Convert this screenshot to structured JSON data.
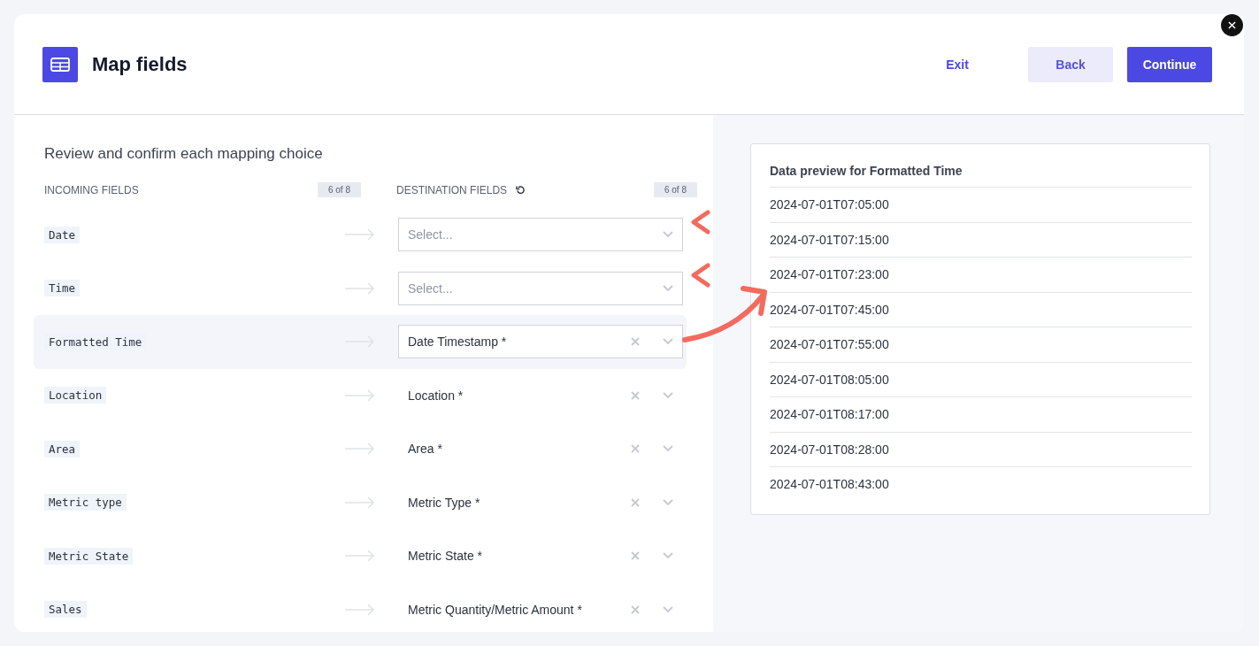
{
  "header": {
    "title": "Map fields",
    "actions": [
      {
        "label": "Exit",
        "kind": "link"
      },
      {
        "label": "Back",
        "kind": "secondary"
      },
      {
        "label": "Continue",
        "kind": "primary"
      }
    ]
  },
  "mapping": {
    "heading": "Review and confirm each mapping choice",
    "incoming_label": "INCOMING FIELDS",
    "incoming_count": "6 of 8",
    "destination_label": "DESTINATION FIELDS",
    "destination_count": "6 of 8",
    "rows": [
      {
        "source": "Date",
        "placeholder": "Select...",
        "selected": false
      },
      {
        "source": "Time",
        "placeholder": "Select...",
        "selected": false
      },
      {
        "source": "Formatted Time",
        "value": "Date Timestamp *",
        "selected": true
      },
      {
        "source": "Location",
        "value": "Location *",
        "selected": false
      },
      {
        "source": "Area",
        "value": "Area *",
        "selected": false
      },
      {
        "source": "Metric type",
        "value": "Metric Type *",
        "selected": false
      },
      {
        "source": "Metric State",
        "value": "Metric State *",
        "selected": false
      },
      {
        "source": "Sales",
        "value": "Metric Quantity/Metric Amount *",
        "selected": false
      }
    ]
  },
  "preview": {
    "title": "Data preview for Formatted Time",
    "values": [
      "2024-07-01T07:05:00",
      "2024-07-01T07:15:00",
      "2024-07-01T07:23:00",
      "2024-07-01T07:45:00",
      "2024-07-01T07:55:00",
      "2024-07-01T08:05:00",
      "2024-07-01T08:17:00",
      "2024-07-01T08:28:00",
      "2024-07-01T08:43:00"
    ]
  }
}
